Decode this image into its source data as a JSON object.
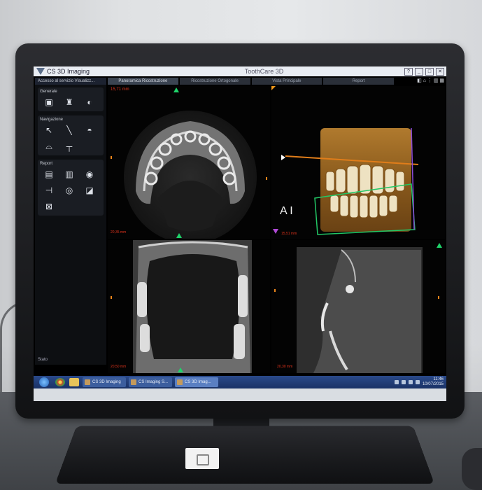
{
  "app": {
    "title": "CS 3D Imaging",
    "center_title": "ToothCare 3D"
  },
  "window_controls": [
    "?",
    "_",
    "□",
    "✕"
  ],
  "sidebar": {
    "header": "Accesso al servizio Visualizz...",
    "groups": [
      {
        "title": "Generale",
        "tools": [
          {
            "icon": "monitor-icon",
            "glyph": "▣"
          },
          {
            "icon": "tooth-icon",
            "glyph": "♜"
          },
          {
            "icon": "mouse-icon",
            "glyph": "◐"
          }
        ]
      },
      {
        "title": "Navigazione",
        "tools": [
          {
            "icon": "arrow-cursor-icon",
            "glyph": "↖"
          },
          {
            "icon": "pen-icon",
            "glyph": "╲"
          },
          {
            "icon": "angle-icon",
            "glyph": "◓"
          },
          {
            "icon": "jaw-icon",
            "glyph": "⌓"
          },
          {
            "icon": "implant-icon",
            "glyph": "┬"
          }
        ]
      },
      {
        "title": "Report",
        "tools": [
          {
            "icon": "document-icon",
            "glyph": "▤"
          },
          {
            "icon": "printer-icon",
            "glyph": "▥"
          },
          {
            "icon": "camera-icon",
            "glyph": "◉"
          },
          {
            "icon": "ruler-icon",
            "glyph": "⊣"
          },
          {
            "icon": "target-icon",
            "glyph": "◎"
          },
          {
            "icon": "export-icon",
            "glyph": "◪"
          },
          {
            "icon": "measure-icon",
            "glyph": "⊠"
          }
        ]
      }
    ],
    "bottom_label": "Stato"
  },
  "tabs": [
    {
      "label": "Panoramica Ricostruzione",
      "active": true
    },
    {
      "label": "Ricostruzione Ortogonale",
      "active": false
    },
    {
      "label": "Vista Principale",
      "active": false
    },
    {
      "label": "Report",
      "active": false
    }
  ],
  "toolbar_icons": "◧ ⌂ ⋮ ▥ ▦",
  "views": {
    "axial": {
      "label_top": "15,71 mm",
      "label_bottom": "20,35 mm"
    },
    "volume": {
      "label_ai": "A I",
      "label_bottom": "15,51 mm"
    },
    "coronal": {
      "label_bottom": "20,50 mm"
    },
    "sagittal": {
      "label_bottom": "20,30 mm"
    }
  },
  "taskbar": {
    "tasks": [
      {
        "label": "CS 3D Imaging",
        "active": false
      },
      {
        "label": "CS Imaging S...",
        "active": false
      },
      {
        "label": "CS 3D Imag...",
        "active": true
      }
    ],
    "clock_time": "11:46",
    "clock_date": "10/07/2015"
  },
  "colors": {
    "accent_green": "#1fd36a",
    "accent_magenta": "#b04ad6",
    "accent_orange": "#f39a1a",
    "label_red": "#e0331c",
    "taskbar_blue": "#1a3266"
  }
}
